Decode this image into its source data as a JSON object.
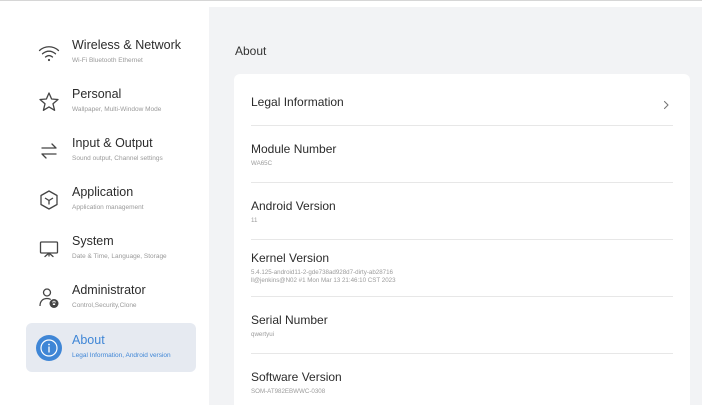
{
  "sidebar": {
    "items": [
      {
        "title": "Wireless & Network",
        "subtitle": "Wi-Fi Bluetooth Ethernet",
        "icon": "wifi-icon"
      },
      {
        "title": "Personal",
        "subtitle": "Wallpaper, Multi-Window Mode",
        "icon": "star-icon"
      },
      {
        "title": "Input & Output",
        "subtitle": "Sound output, Channel settings",
        "icon": "swap-arrows-icon"
      },
      {
        "title": "Application",
        "subtitle": "Application management",
        "icon": "package-icon"
      },
      {
        "title": "System",
        "subtitle": "Date & Time, Language, Storage",
        "icon": "monitor-icon"
      },
      {
        "title": "Administrator",
        "subtitle": "Control,Security,Clone",
        "icon": "admin-user-icon"
      },
      {
        "title": "About",
        "subtitle": "Legal Information, Android version",
        "icon": "info-icon"
      }
    ],
    "active_index": 6,
    "accent_color": "#3f86d6"
  },
  "main": {
    "title": "About",
    "rows": [
      {
        "title": "Legal Information",
        "value": "",
        "has_chevron": true
      },
      {
        "title": "Module Number",
        "value": "WA65C"
      },
      {
        "title": "Android Version",
        "value": "11"
      },
      {
        "title": "Kernel Version",
        "value": "5.4.125-android11-2-gde738ad928d7-dirty-ab28716",
        "value2": "ll@jenkins@N02 #1 Mon Mar 13 21:46:10 CST 2023"
      },
      {
        "title": "Serial Number",
        "value": "qwertyui"
      },
      {
        "title": "Software Version",
        "value": "SOM-AT982EBWWC-0308"
      }
    ]
  }
}
